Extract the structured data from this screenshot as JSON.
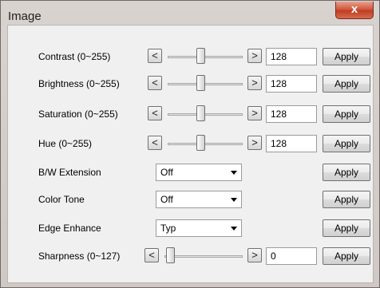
{
  "window": {
    "title": "Image",
    "close_glyph": "x"
  },
  "buttons": {
    "decrement": "<",
    "increment": ">",
    "apply": "Apply"
  },
  "sliders": [
    {
      "label": "Contrast (0~255)",
      "value": "128",
      "position_fraction": 0.5
    },
    {
      "label": "Brightness (0~255)",
      "value": "128",
      "position_fraction": 0.5
    },
    {
      "label": "Saturation (0~255)",
      "value": "128",
      "position_fraction": 0.5
    },
    {
      "label": "Hue (0~255)",
      "value": "128",
      "position_fraction": 0.5
    }
  ],
  "dropdowns": [
    {
      "label": "B/W Extension",
      "value": "Off"
    },
    {
      "label": "Color Tone",
      "value": "Off"
    },
    {
      "label": "Edge Enhance",
      "value": "Typ"
    }
  ],
  "sharpness": {
    "label": "Sharpness (0~127)",
    "value": "0",
    "position_fraction": 0.0
  },
  "colors": {
    "close_button": "#c13d22",
    "dialog_background": "#f0f0f0"
  }
}
